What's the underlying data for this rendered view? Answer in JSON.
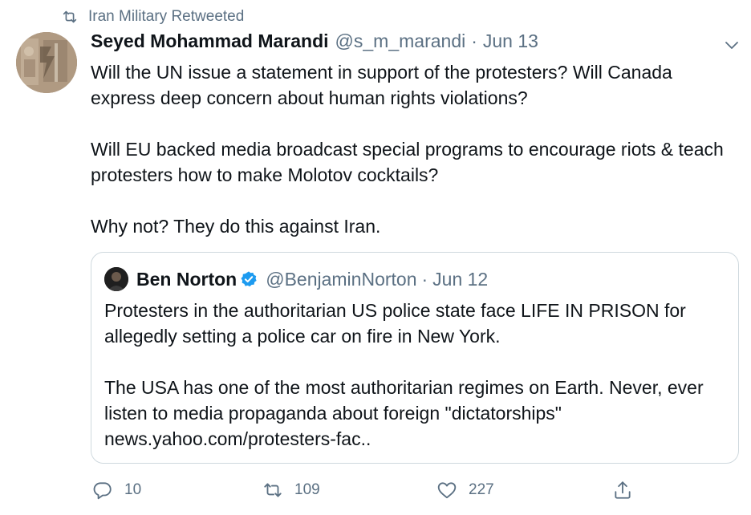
{
  "retweet_banner": {
    "icon": "retweet-icon",
    "text": "Iran Military Retweeted"
  },
  "tweet": {
    "author_name": "Seyed Mohammad Marandi",
    "author_handle": "@s_m_marandi",
    "separator": "·",
    "date": "Jun 13",
    "more_icon": "chevron-down-icon",
    "paragraphs": [
      "Will the UN issue a statement in support of the protesters? Will Canada express deep concern about human rights violations?",
      "Will EU backed media broadcast special programs to encourage riots & teach protesters how to make Molotov cocktails?",
      "Why not? They do this against Iran."
    ]
  },
  "quoted_tweet": {
    "author_name": "Ben Norton",
    "verified_icon": "verified-badge-icon",
    "author_handle": "@BenjaminNorton",
    "separator": "·",
    "date": "Jun 12",
    "paragraphs": [
      "Protesters in the authoritarian US police state face LIFE IN PRISON for allegedly setting a police car on fire in New York.",
      "The USA has one of the most authoritarian regimes on Earth. Never, ever listen to media propaganda about foreign \"dictatorships\" news.yahoo.com/protesters-fac.."
    ]
  },
  "actions": {
    "reply_count": "10",
    "retweet_count": "109",
    "like_count": "227",
    "share_icon": "share-icon"
  },
  "colors": {
    "text_primary": "#0f1419",
    "text_secondary": "#5b7083",
    "border": "#cfd9de",
    "verified_blue": "#1d9bf0"
  }
}
